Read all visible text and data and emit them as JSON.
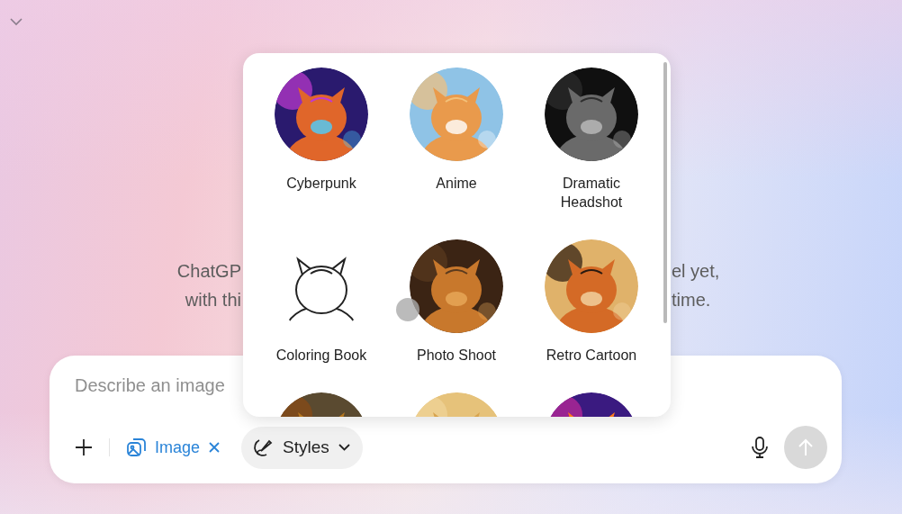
{
  "background_message": {
    "lines": [
      {
        "left": "ChatGP",
        "right": "el yet,"
      },
      {
        "left": "with thi",
        "right": "time."
      }
    ]
  },
  "styles_popup": {
    "items": [
      {
        "kind": "picture",
        "label": "Cyberpunk"
      },
      {
        "kind": "picture",
        "label": "Anime"
      },
      {
        "kind": "picture",
        "label": "Dramatic Headshot"
      },
      {
        "kind": "picture",
        "label": "Coloring Book"
      },
      {
        "kind": "picture",
        "label": "Photo Shoot"
      },
      {
        "kind": "picture",
        "label": "Retro Cartoon"
      },
      {
        "kind": "picture"
      },
      {
        "kind": "picture"
      },
      {
        "kind": "picture"
      }
    ]
  },
  "composer": {
    "placeholder": "Describe an image",
    "image_chip": {
      "label": "Image"
    },
    "styles_button": {
      "label": "Styles"
    },
    "send_button": {
      "disabled": true
    }
  }
}
